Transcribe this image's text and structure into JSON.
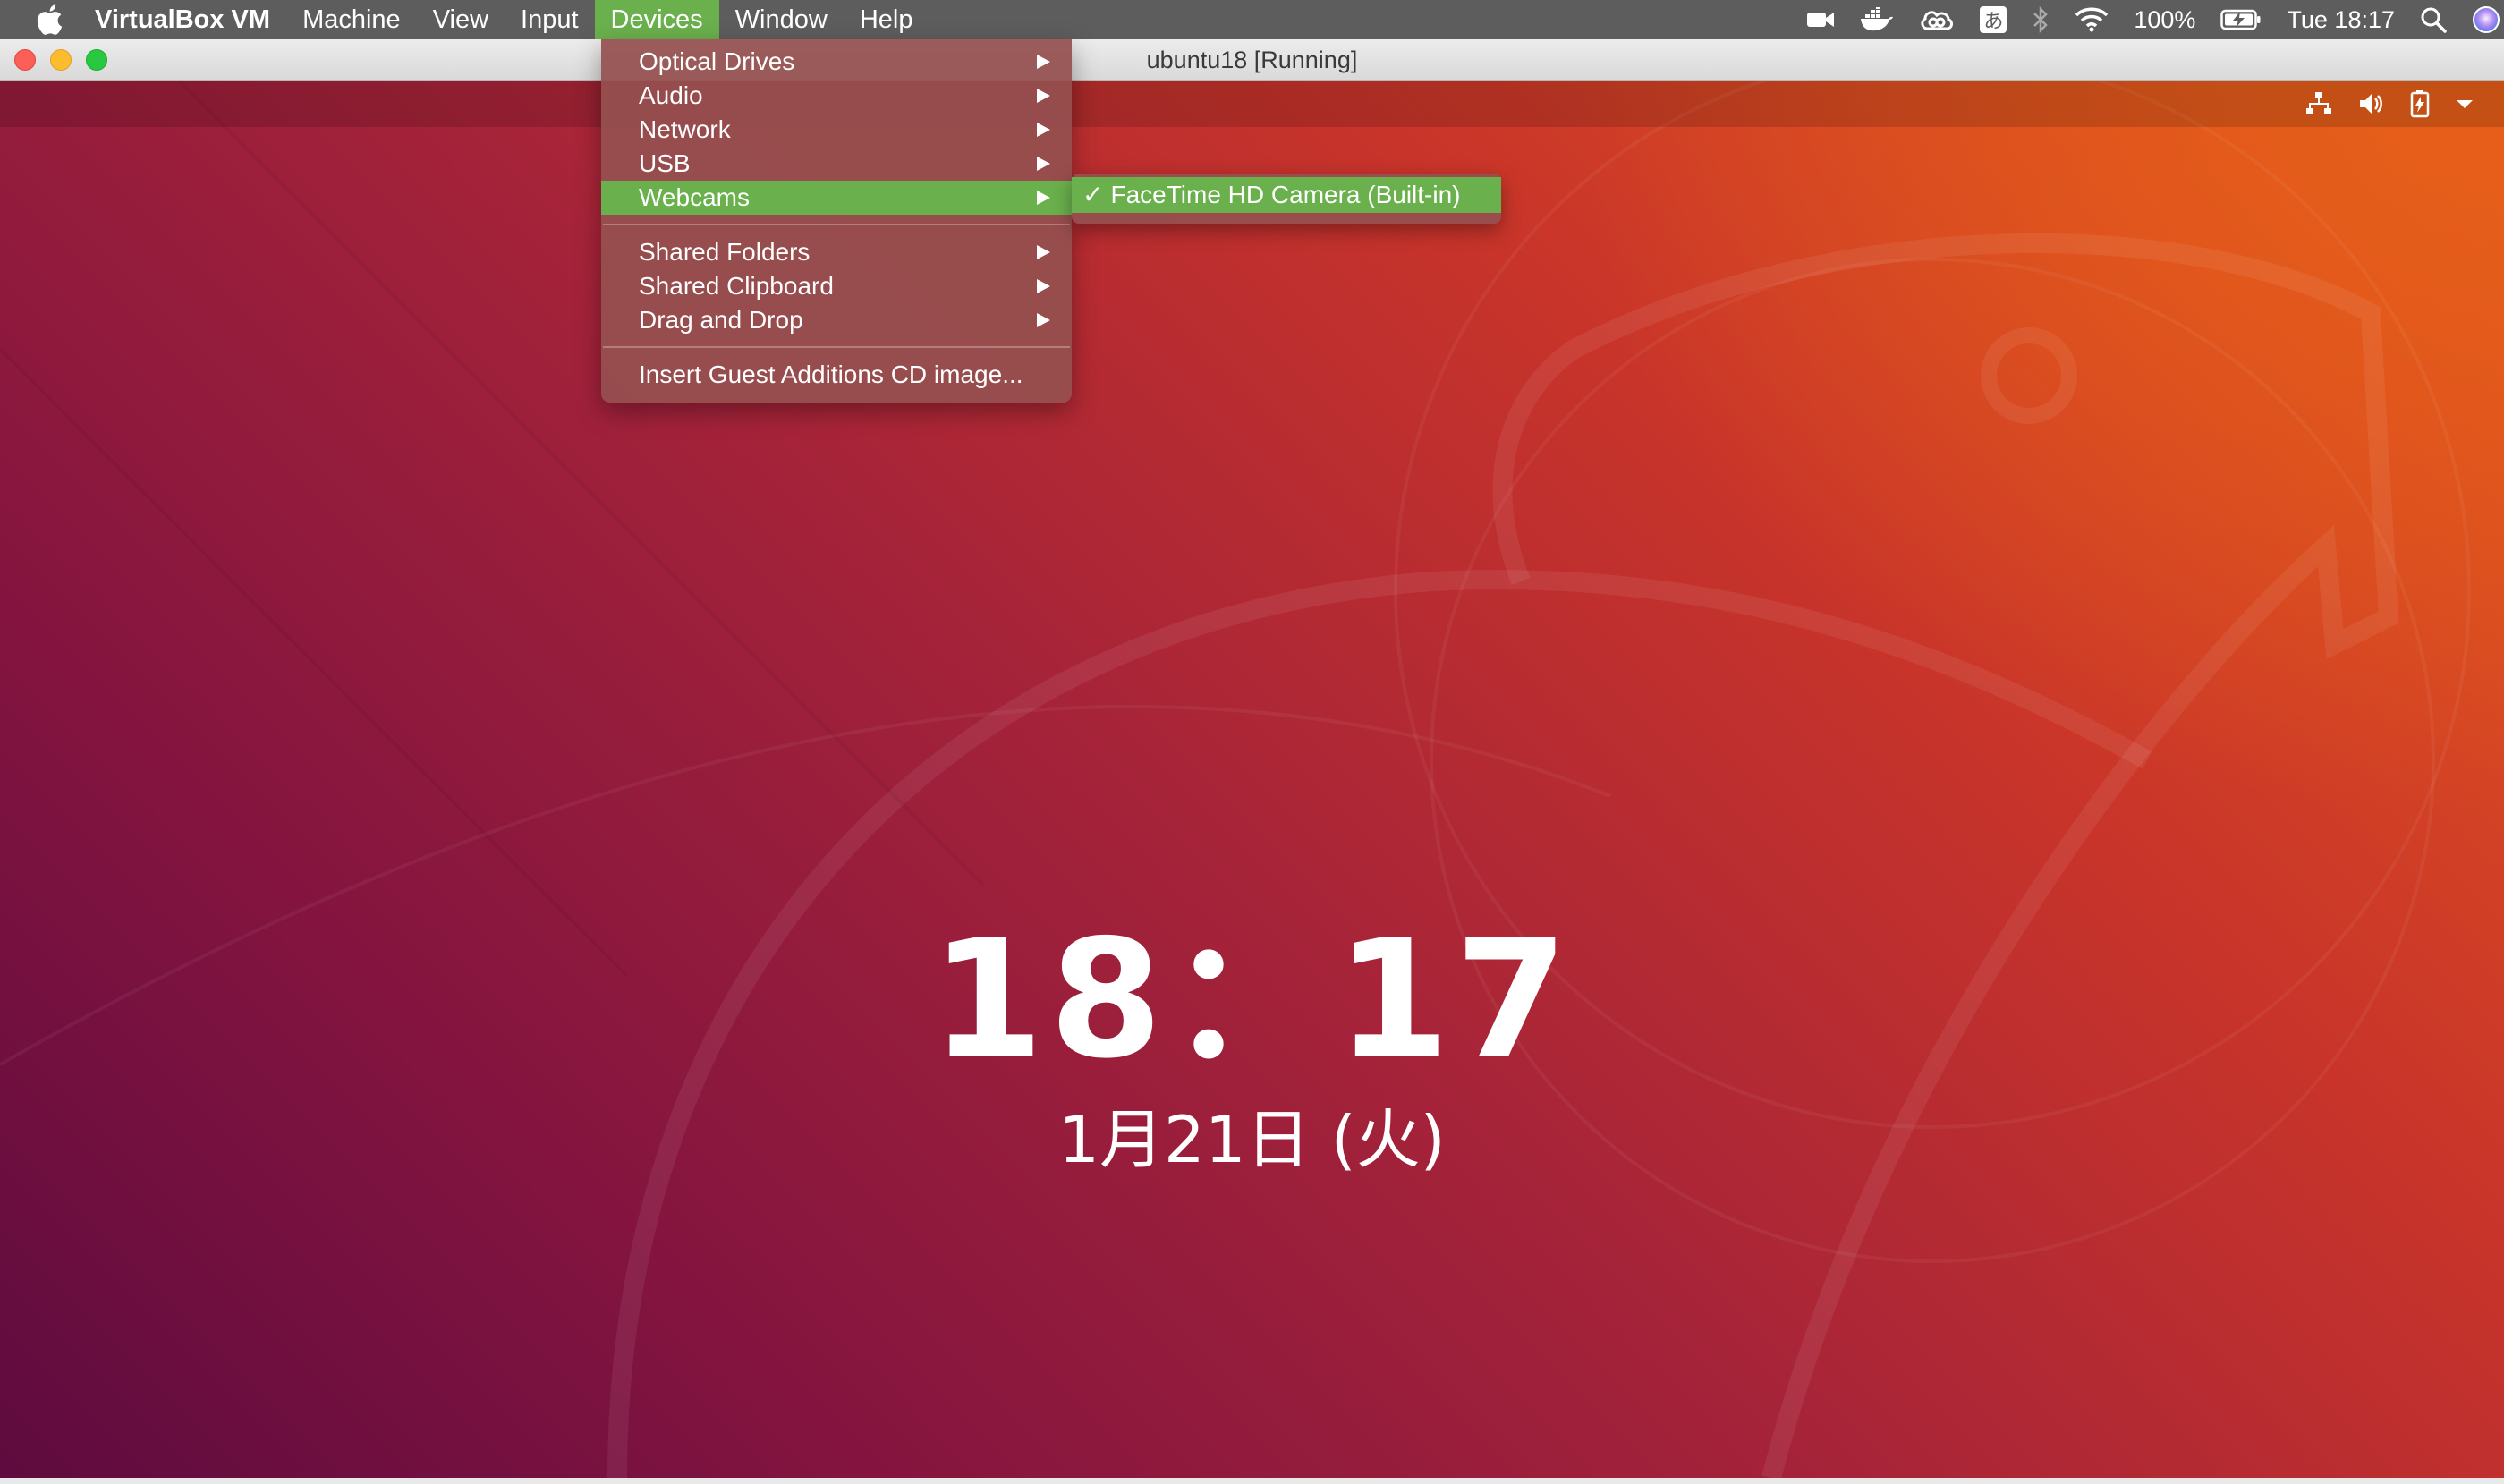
{
  "menubar": {
    "app_name": "VirtualBox VM",
    "items": [
      "Machine",
      "View",
      "Input",
      "Devices",
      "Window",
      "Help"
    ],
    "active_item": "Devices"
  },
  "statusbar": {
    "battery": "100%",
    "clock": "Tue 18:17",
    "input_method": "あ"
  },
  "window": {
    "title": "ubuntu18 [Running]"
  },
  "devices_menu": {
    "items": [
      "Optical Drives",
      "Audio",
      "Network",
      "USB",
      "Webcams"
    ],
    "items2": [
      "Shared Folders",
      "Shared Clipboard",
      "Drag and Drop"
    ],
    "items3": [
      "Insert Guest Additions CD image..."
    ],
    "highlighted": "Webcams"
  },
  "webcams_submenu": {
    "check": "✓",
    "item": "FaceTime HD Camera (Built-in)"
  },
  "lock_screen": {
    "time": "18：17",
    "date": "1月21日 (火)"
  }
}
